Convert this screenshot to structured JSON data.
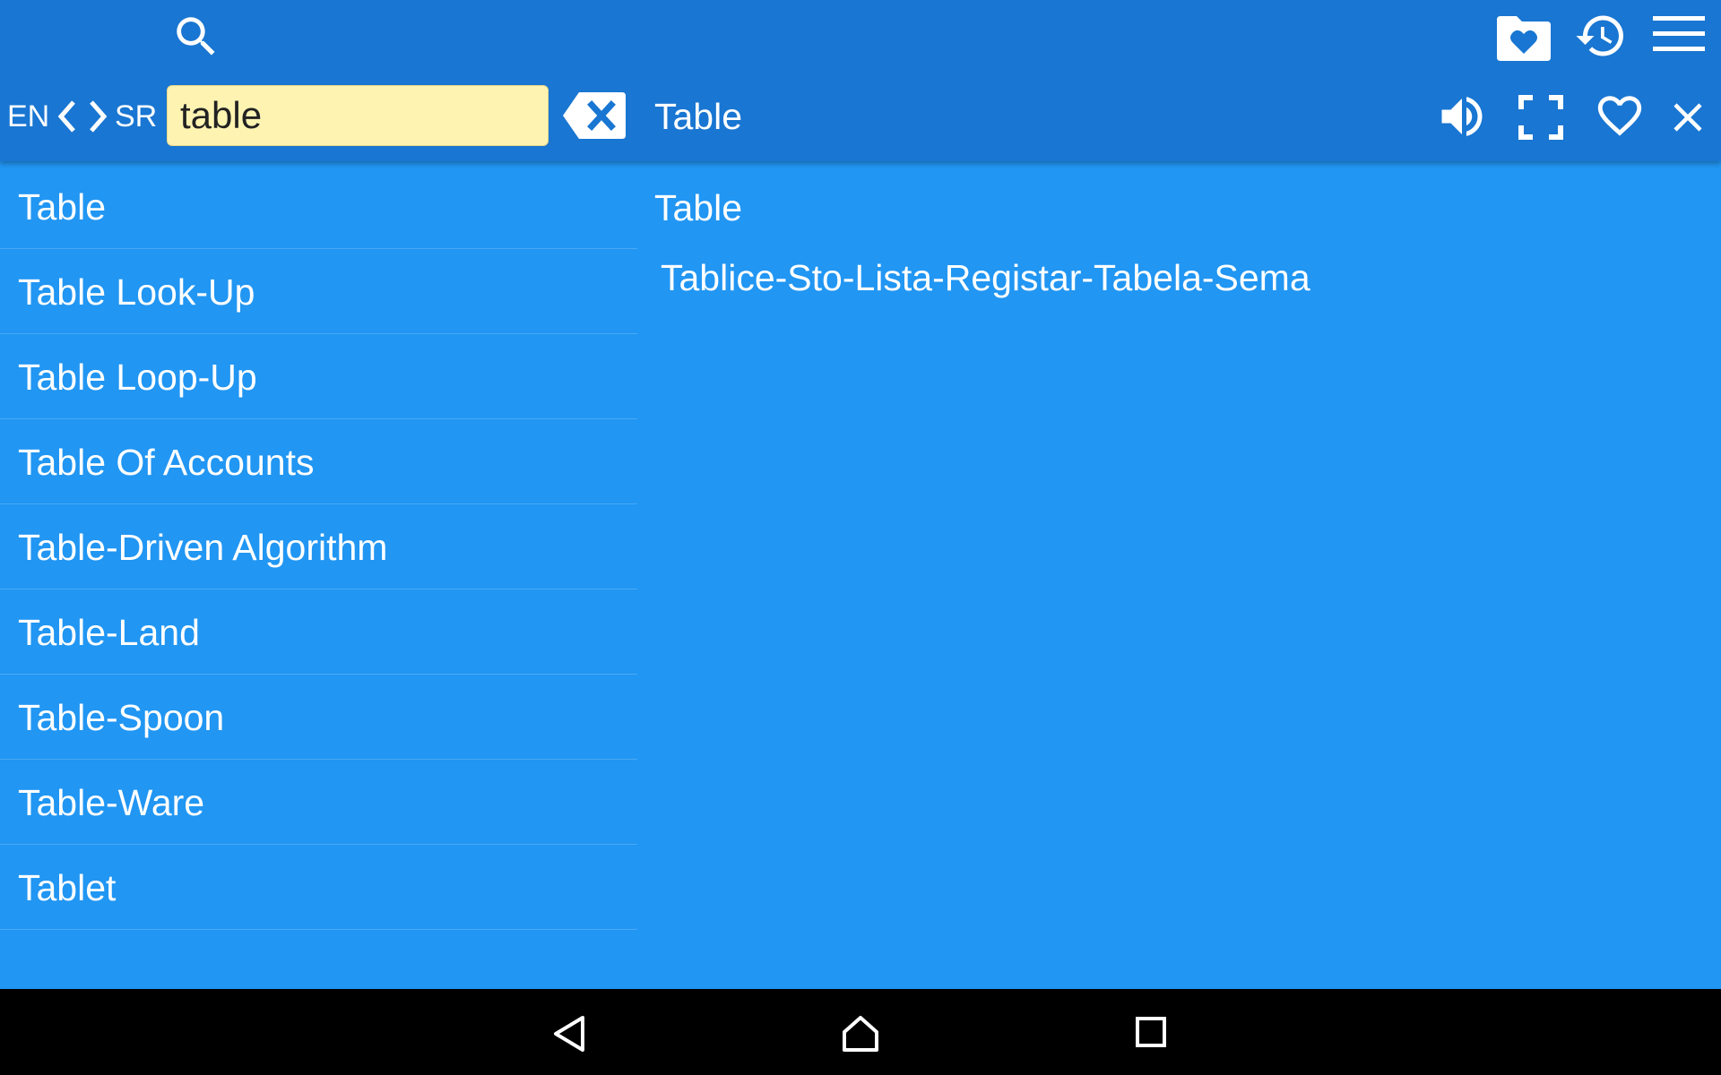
{
  "app": {
    "accent_color": "#1976d2",
    "background_color": "#2196f3",
    "search_field_color": "#fff3b2"
  },
  "toolbar": {
    "search_icon": "search-icon",
    "favorites_icon": "favorites-folder-icon",
    "history_icon": "history-icon",
    "menu_icon": "menu-icon"
  },
  "language_bar": {
    "source": "EN",
    "target": "SR",
    "swap_icon": "swap-arrows-icon"
  },
  "search": {
    "value": "table",
    "clear_icon": "clear-backspace-icon"
  },
  "header": {
    "title": "Table",
    "speaker_icon": "speaker-icon",
    "fullscreen_icon": "fullscreen-icon",
    "favorite_icon": "heart-icon",
    "close_icon": "close-icon"
  },
  "results": [
    "Table",
    "Table Look-Up",
    "Table Loop-Up",
    "Table Of Accounts",
    "Table-Driven Algorithm",
    "Table-Land",
    "Table-Spoon",
    "Table-Ware",
    "Tablet"
  ],
  "detail": {
    "headword": "Table",
    "translation": "Tablice-Sto-Lista-Registar-Tabela-Sema"
  },
  "navbar": {
    "back_icon": "back-triangle-icon",
    "home_icon": "home-icon",
    "recents_icon": "recents-square-icon"
  }
}
